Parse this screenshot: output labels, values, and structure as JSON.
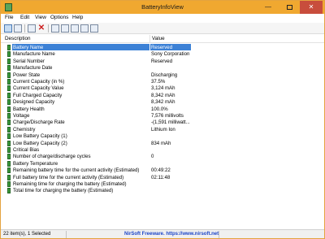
{
  "window": {
    "title": "BatteryInfoView",
    "min_glyph": "—",
    "close_glyph": "✕"
  },
  "menu": [
    "File",
    "Edit",
    "View",
    "Options",
    "Help"
  ],
  "columns": {
    "description": "Description",
    "value": "Value"
  },
  "rows": [
    {
      "name": "Battery Name",
      "value": "Reserved"
    },
    {
      "name": "Manufacture Name",
      "value": "Sony Corporation"
    },
    {
      "name": "Serial Number",
      "value": "Reserved"
    },
    {
      "name": "Manufacture Date",
      "value": ""
    },
    {
      "name": "Power State",
      "value": "Discharging"
    },
    {
      "name": "Current Capacity (in %)",
      "value": "37.5%"
    },
    {
      "name": "Current Capacity Value",
      "value": "3,124 mAh"
    },
    {
      "name": "Full Charged Capacity",
      "value": "8,342 mAh"
    },
    {
      "name": "Designed Capacity",
      "value": "8,342 mAh"
    },
    {
      "name": "Battery Health",
      "value": "100.0%"
    },
    {
      "name": "Voltage",
      "value": "7,576 millivolts"
    },
    {
      "name": "Charge/Discharge Rate",
      "value": "-(1,591 milliwatt..."
    },
    {
      "name": "Chemistry",
      "value": "Lithium Ion"
    },
    {
      "name": "Low Battery Capacity (1)",
      "value": ""
    },
    {
      "name": "Low Battery Capacity (2)",
      "value": "834 mAh"
    },
    {
      "name": "Critical Bias",
      "value": ""
    },
    {
      "name": "Number of charge/discharge cycles",
      "value": "0"
    },
    {
      "name": "Battery Temperature",
      "value": ""
    },
    {
      "name": "Remaining battery time for the current activity (Estimated)",
      "value": "00:49:22"
    },
    {
      "name": "Full battery time for the current activity (Estimated)",
      "value": "02:11:48"
    },
    {
      "name": "Remaining time for charging the battery (Estimated)",
      "value": ""
    },
    {
      "name": "Total  time for charging the battery (Estimated)",
      "value": ""
    }
  ],
  "selected_index": 0,
  "status": {
    "count": "22 item(s), 1 Selected",
    "credit": "NirSoft Freeware.  https://www.nirsoft.net"
  },
  "colors": {
    "titlebar": "#f0a830",
    "selection": "#3c81d6",
    "link": "#1b44c8"
  }
}
